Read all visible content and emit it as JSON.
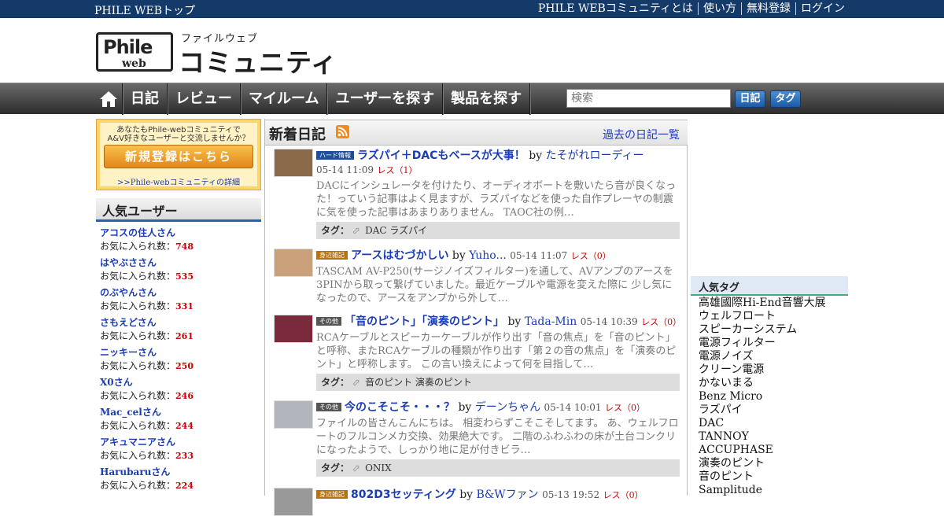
{
  "topbar": {
    "home": "PHILE WEBトップ",
    "links": [
      "PHILE WEBコミュニティとは",
      "使い方",
      "無料登録",
      "ログイン"
    ]
  },
  "logo": {
    "badge_main": "Phile",
    "badge_sub": "web",
    "kana": "ファイルウェブ",
    "title": "コミュニティ"
  },
  "nav": {
    "items": [
      "日記",
      "レビュー",
      "マイルーム",
      "ユーザーを探す",
      "製品を探す"
    ],
    "search_placeholder": "検索",
    "btn_diary": "日記",
    "btn_tag": "タグ"
  },
  "register": {
    "msg1": "あなたもPhile-webコミュニティで",
    "msg2": "A&V好きなユーザーと交流しませんか？",
    "cta": "新規登録はこちら",
    "detail": ">>Phile-webコミュニティの詳細"
  },
  "popular_users": {
    "title": "人気ユーザー",
    "fav_label": "お気に入られ数：",
    "items": [
      {
        "name": "アコスの住人さん",
        "count": "748"
      },
      {
        "name": "はやぶささん",
        "count": "535"
      },
      {
        "name": "のぶやんさん",
        "count": "331"
      },
      {
        "name": "さもえどさん",
        "count": "261"
      },
      {
        "name": "ニッキーさん",
        "count": "250"
      },
      {
        "name": "X0さん",
        "count": "246"
      },
      {
        "name": "Mac_celさん",
        "count": "244"
      },
      {
        "name": "アキュマニアさん",
        "count": "233"
      },
      {
        "name": "Harubaruさん",
        "count": "224"
      }
    ]
  },
  "main": {
    "title": "新着日記",
    "past_link": "過去の日記一覧",
    "tag_label": "タグ：",
    "by": "by",
    "entries": [
      {
        "category": "ハード情報",
        "cat_color": "#1f4e9a",
        "title": "ラズパイ＋DACもベースが大事！",
        "author": "たそがれローディー",
        "date": "05-14 11:09",
        "res": "レス（1）",
        "excerpt": "DACにインシュレータを付けたり、オーディオボートを敷いたら音が良くなった！っていう記事はよく見ますが、ラズパイなどを使った自作プレーヤの制震に気を使った記事はあまりありません。 TAOC社の例…",
        "tags": "DAC ラズパイ"
      },
      {
        "category": "身辺雑記",
        "cat_color": "#b6730f",
        "title": "アースはむづかしい",
        "author": "Yuho...",
        "date": "05-14 11:07",
        "res": "レス（0）",
        "excerpt": "TASCAM AV-P250(サージノイズフィルター)を通して、AVアンプのアースを3PINから取って繋げていました。最近ケーブルや電源を変えた際に 少し気になったので、アースをアンプから外して…",
        "tags": ""
      },
      {
        "category": "その他",
        "cat_color": "#555555",
        "title": "「音のピント」「演奏のピント」",
        "author": "Tada-Min",
        "date": "05-14 10:39",
        "res": "レス（0）",
        "excerpt": "RCAケーブルとスピーカーケーブルが作り出す「音の焦点」を「音のピント」と呼称、またRCAケーブルの種類が作り出す「第２の音の焦点」を「演奏のピント」と呼称します。 この言い換えによって何を目指して…",
        "tags": "音のピント 演奏のピント"
      },
      {
        "category": "その他",
        "cat_color": "#555555",
        "title": "今のこそこそ・・・？",
        "author": "デーンちゃん",
        "date": "05-14 10:01",
        "res": "レス（0）",
        "excerpt": "ファイルの皆さんこんにちは。 相変わらずこそこそしてます。 あ、ウェルフロートのフルコンメカ交換、効果絶大です。 二階のふわふわの床が土台コンクリになったようで、しっかり地に足が付きビラ…",
        "tags": "ONIX"
      },
      {
        "category": "身辺雑記",
        "cat_color": "#b6730f",
        "title": "802D3セッティング",
        "author": "B&Wファン",
        "date": "05-13 19:52",
        "res": "レス（0）",
        "excerpt": "",
        "tags": ""
      }
    ]
  },
  "popular_tags": {
    "title": "人気タグ",
    "items": [
      "高雄國際Hi-End音響大展",
      "ウェルフロート",
      "スピーカーシステム",
      "電源フィルター",
      "電源ノイズ",
      "クリーン電源",
      "かないまる",
      "Benz Micro",
      "ラズパイ",
      "DAC",
      "TANNOY",
      "ACCUPHASE",
      "演奏のピント",
      "音のピント",
      "Samplitude"
    ]
  }
}
